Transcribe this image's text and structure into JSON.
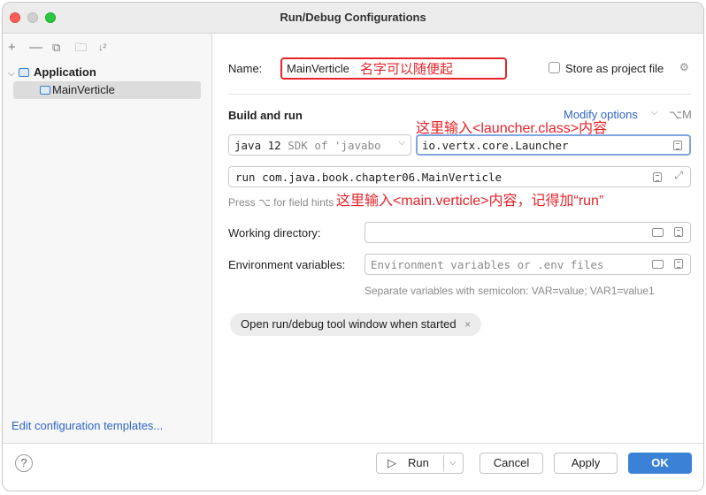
{
  "window": {
    "title": "Run/Debug Configurations"
  },
  "toolbar": {
    "add": "+",
    "remove": "—",
    "copy": "⧉",
    "folder": "🗀",
    "sort": "↓²"
  },
  "tree": {
    "group": "Application",
    "item": "MainVerticle"
  },
  "edit_templates": "Edit configuration templates...",
  "name": {
    "label": "Name:",
    "value": "MainVerticle",
    "annotation": "名字可以随便起"
  },
  "store": {
    "label": "Store as project file"
  },
  "build": {
    "heading": "Build and run",
    "modify": "Modify options",
    "modify_shortcut": "⌥M",
    "jdk": "java 12",
    "jdk_hint": "SDK of 'javabo",
    "main_class": "io.vertx.core.Launcher",
    "main_class_annotation": "这里输入<launcher.class>内容",
    "args": "run com.java.book.chapter06.MainVerticle",
    "hint": "Press ⌥ for field hints",
    "args_annotation": "这里输入<main.verticle>内容，记得加“run”"
  },
  "workdir": {
    "label": "Working directory:",
    "value": ""
  },
  "env": {
    "label": "Environment variables:",
    "placeholder": "Environment variables or .env files",
    "note": "Separate variables with semicolon: VAR=value; VAR1=value1"
  },
  "chip": {
    "label": "Open run/debug tool window when started",
    "close": "×"
  },
  "buttons": {
    "run": "Run",
    "cancel": "Cancel",
    "apply": "Apply",
    "ok": "OK",
    "help": "?"
  }
}
